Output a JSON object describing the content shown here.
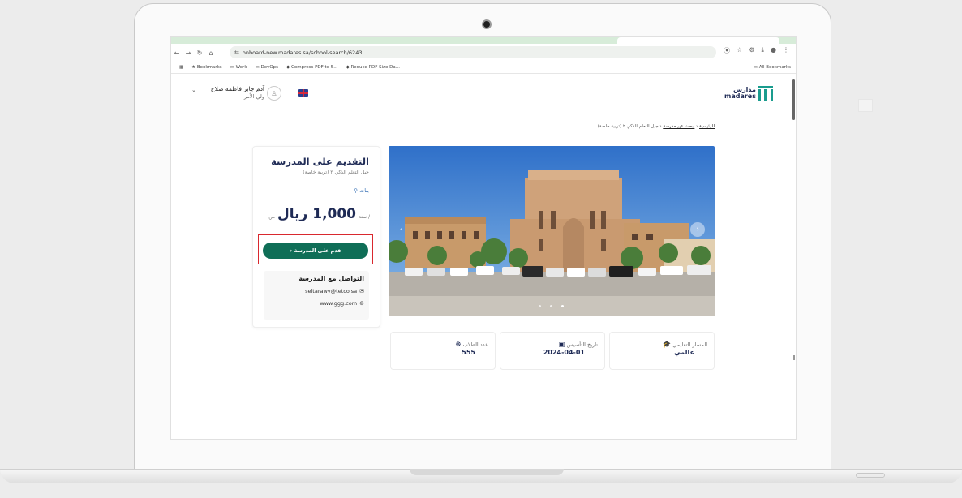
{
  "browser": {
    "url": "onboard-new.madares.sa/school-search/6243",
    "bookmarks": [
      "Bookmarks",
      "Work",
      "DevOps",
      "Compress PDF to 5...",
      "Reduce PDF Size Da..."
    ],
    "all_bookmarks": "All Bookmarks"
  },
  "header": {
    "user_name": "آدم جابر فاطمة صلاح",
    "user_role": "ولي الأمر",
    "logo_ar": "مدارس",
    "logo_en": "madares"
  },
  "breadcrumb": {
    "home": "الرئيسية",
    "search": "إبحث عن مدرسة",
    "current": "جيل التعلم الذكي ٢ (تربية خاصة)",
    "sep": "‹"
  },
  "school": {
    "apply_title": "التقديم على المدرسة",
    "name": "جيل التعلم الذكي ٢ (تربية خاصة)",
    "gender": "بنات",
    "price_from": "من",
    "price": "1,000 ريال",
    "price_per": "/ سنة",
    "apply_button": "قدم على المدرسة",
    "contact_title": "التواصل مع المدرسة",
    "email": "seltarawy@tetco.sa",
    "website": "www.ggg.com"
  },
  "info_cards": [
    {
      "label": "المسار التعليمي",
      "value": "عالمي"
    },
    {
      "label": "تاريخ التأسيس",
      "value": "2024-04-01"
    },
    {
      "label": "عدد الطلاب",
      "value": "555"
    }
  ],
  "colors": {
    "brand_green": "#0f6e57",
    "navy": "#1e2a55",
    "highlight_red": "#d9282e"
  }
}
